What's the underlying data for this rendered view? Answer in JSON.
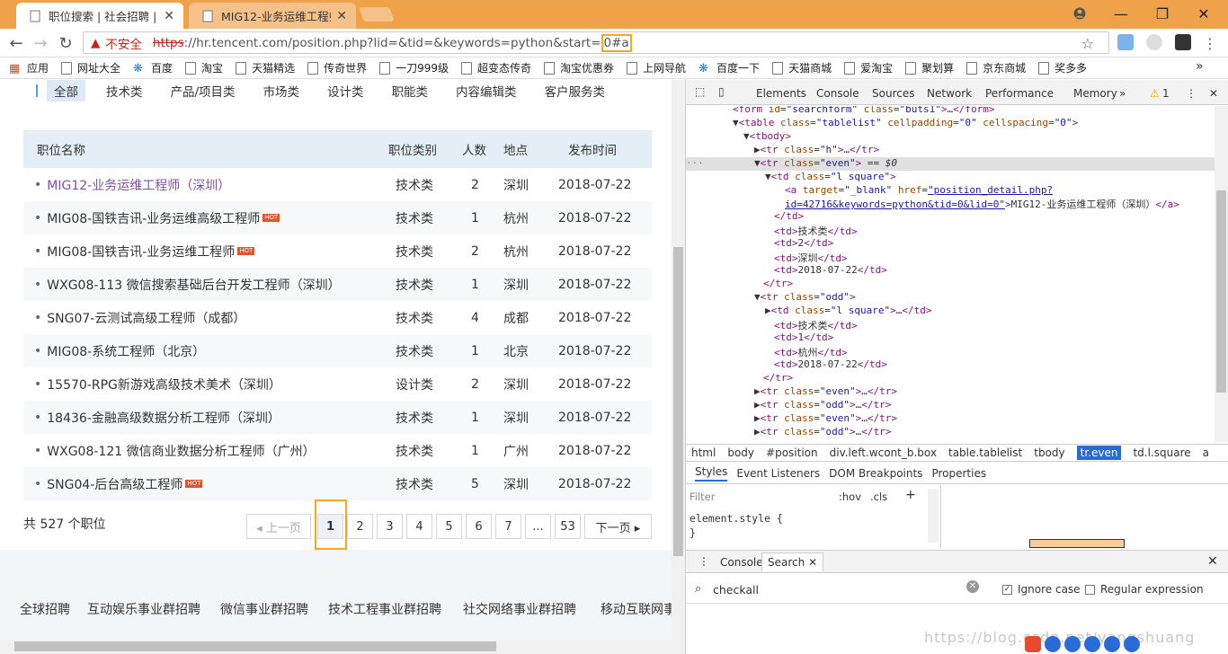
{
  "browser": {
    "tabs": [
      {
        "title": "职位搜索 | 社会招聘 | Ten",
        "active": true
      },
      {
        "title": "MIG12-业务运维工程师",
        "active": false
      }
    ],
    "address": {
      "warning": "不安全",
      "scheme": "https",
      "url_main": "://hr.tencent.com/position.php?lid=&tid=&keywords=python&start=",
      "url_highlight": "0#a"
    },
    "bookmarks": [
      "应用",
      "网址大全",
      "百度",
      "淘宝",
      "天猫精选",
      "传奇世界",
      "一刀999级",
      "超变态传奇",
      "淘宝优惠券",
      "上网导航",
      "百度一下",
      "天猫商城",
      "爱淘宝",
      "聚划算",
      "京东商城",
      "奖多多"
    ],
    "bookmarks_more": "»"
  },
  "page": {
    "categories": [
      "全部",
      "技术类",
      "产品/项目类",
      "市场类",
      "设计类",
      "职能类",
      "内容编辑类",
      "客户服务类"
    ],
    "active_category": "全部",
    "table_headers": [
      "职位名称",
      "职位类别",
      "人数",
      "地点",
      "发布时间"
    ],
    "rows": [
      {
        "name": "MIG12-业务运维工程师（深圳）",
        "hot": false,
        "category": "技术类",
        "count": "2",
        "location": "深圳",
        "date": "2018-07-22"
      },
      {
        "name": "MIG08-国铁吉讯-业务运维高级工程师",
        "hot": true,
        "category": "技术类",
        "count": "1",
        "location": "杭州",
        "date": "2018-07-22"
      },
      {
        "name": "MIG08-国铁吉讯-业务运维工程师",
        "hot": true,
        "category": "技术类",
        "count": "2",
        "location": "杭州",
        "date": "2018-07-22"
      },
      {
        "name": "WXG08-113 微信搜索基础后台开发工程师（深圳）",
        "hot": false,
        "category": "技术类",
        "count": "1",
        "location": "深圳",
        "date": "2018-07-22"
      },
      {
        "name": "SNG07-云测试高级工程师（成都）",
        "hot": false,
        "category": "技术类",
        "count": "4",
        "location": "成都",
        "date": "2018-07-22"
      },
      {
        "name": "MIG08-系统工程师（北京）",
        "hot": false,
        "category": "技术类",
        "count": "1",
        "location": "北京",
        "date": "2018-07-22"
      },
      {
        "name": "15570-RPG新游戏高级技术美术（深圳）",
        "hot": false,
        "category": "设计类",
        "count": "2",
        "location": "深圳",
        "date": "2018-07-22"
      },
      {
        "name": "18436-金融高级数据分析工程师（深圳）",
        "hot": false,
        "category": "技术类",
        "count": "1",
        "location": "深圳",
        "date": "2018-07-22"
      },
      {
        "name": "WXG08-121 微信商业数据分析工程师（广州）",
        "hot": false,
        "category": "技术类",
        "count": "1",
        "location": "广州",
        "date": "2018-07-22"
      },
      {
        "name": "SNG04-后台高级工程师",
        "hot": true,
        "category": "技术类",
        "count": "5",
        "location": "深圳",
        "date": "2018-07-22"
      }
    ],
    "hot_label": "HOT",
    "total": "共 527 个职位",
    "pagination": {
      "prev": "上一页",
      "pages": [
        "1",
        "2",
        "3",
        "4",
        "5",
        "6",
        "7",
        "...",
        "53"
      ],
      "current": "1",
      "next": "下一页"
    },
    "footer_links": [
      "全球招聘",
      "互动娱乐事业群招聘",
      "微信事业群招聘",
      "技术工程事业群招聘",
      "社交网络事业群招聘",
      "移动互联网事"
    ]
  },
  "devtools": {
    "tabs": [
      "Elements",
      "Console",
      "Sources",
      "Network",
      "Performance",
      "Memory",
      "»"
    ],
    "warnings": "1",
    "breadcrumbs": [
      "html",
      "body",
      "#position",
      "div.left.wcont_b.box",
      "table.tablelist",
      "tbody",
      "tr.even",
      "td.l.square",
      "a"
    ],
    "selected_crumb": "tr.even",
    "subtabs": [
      "Styles",
      "Event Listeners",
      "DOM Breakpoints",
      "Properties"
    ],
    "filter_placeholder": "Filter",
    "hov": ":hov",
    "cls": ".cls",
    "element_style": "element.style {",
    "element_style_close": "}",
    "drawer_tabs": [
      "Console",
      "Search"
    ],
    "search_value": "checkall",
    "ignore_case": "Ignore case",
    "regex": "Regular expression"
  },
  "watermark": "https://blog.csdn.net/yangshuang",
  "colors": {
    "tabstrip": "#f0a24b",
    "highlight": "#f6a623",
    "link_visited": "#7e52a0",
    "hot": "#e2532f"
  }
}
